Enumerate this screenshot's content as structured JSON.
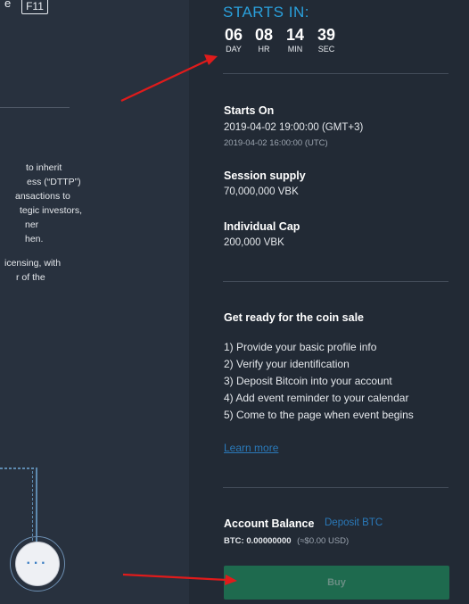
{
  "left_panel": {
    "key_prefix": "e",
    "key_badge": "F11",
    "paragraph1": [
      "to inherit",
      "ess (“DTTP”)",
      "ansactions to",
      "tegic investors,",
      "ner",
      "hen."
    ],
    "paragraph2": [
      "icensing, with",
      "r of the"
    ],
    "more_button": "···"
  },
  "countdown": {
    "heading": "STARTS IN:",
    "day": {
      "value": "06",
      "label": "DAY"
    },
    "hr": {
      "value": "08",
      "label": "HR"
    },
    "min": {
      "value": "14",
      "label": "MIN"
    },
    "sec": {
      "value": "39",
      "label": "SEC"
    }
  },
  "sale_info": {
    "starts_on_label": "Starts On",
    "starts_on_local": "2019-04-02 19:00:00 (GMT+3)",
    "starts_on_utc": "2019-04-02 16:00:00 (UTC)",
    "session_supply_label": "Session supply",
    "session_supply_value": "70,000,000 VBK",
    "individual_cap_label": "Individual Cap",
    "individual_cap_value": "200,000 VBK"
  },
  "get_ready": {
    "title": "Get ready for the coin sale",
    "steps": [
      "1) Provide your basic profile info",
      "2) Verify your identification",
      "3) Deposit Bitcoin into your account",
      "4) Add event reminder to your calendar",
      "5) Come to the page when event begins"
    ],
    "learn_more": "Learn more"
  },
  "account": {
    "balance_label": "Account Balance",
    "deposit_link": "Deposit BTC",
    "btc_balance": "BTC: 0.00000000",
    "usd_equiv": "(≈$0.00 USD)",
    "buy_label": "Buy"
  },
  "colors": {
    "accent_blue": "#2aa0dc",
    "link_blue": "#2a79b9",
    "buy_green": "#1e6a4e",
    "annotation_arrow": "#e01b1b"
  }
}
